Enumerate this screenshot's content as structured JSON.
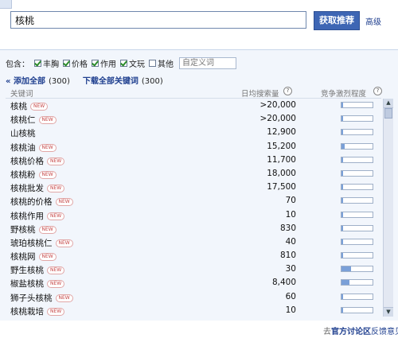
{
  "header": {
    "search_value": "核桃",
    "search_button": "获取推荐",
    "advanced_link": "高级"
  },
  "filters": {
    "label": "包含：",
    "options": [
      {
        "label": "丰胸",
        "checked": true
      },
      {
        "label": "价格",
        "checked": true
      },
      {
        "label": "作用",
        "checked": true
      },
      {
        "label": "文玩",
        "checked": true
      },
      {
        "label": "其他",
        "checked": false
      }
    ],
    "custom_placeholder": "自定义词"
  },
  "actions": {
    "add_all_arrow": "«",
    "add_all": "添加全部",
    "add_all_count": "(300)",
    "download_all": "下载全部关键词",
    "download_count": "(300)"
  },
  "table": {
    "headers": {
      "keyword": "关键词",
      "volume": "日均搜索量",
      "competition": "竞争激烈程度"
    },
    "rows": [
      {
        "keyword": "核桃",
        "new": true,
        "volume": ">20,000",
        "competition": 0.06
      },
      {
        "keyword": "核桃仁",
        "new": true,
        "volume": ">20,000",
        "competition": 0.06
      },
      {
        "keyword": "山核桃",
        "new": false,
        "volume": "12,900",
        "competition": 0.06
      },
      {
        "keyword": "核桃油",
        "new": true,
        "volume": "15,200",
        "competition": 0.1
      },
      {
        "keyword": "核桃价格",
        "new": true,
        "volume": "11,700",
        "competition": 0.06
      },
      {
        "keyword": "核桃粉",
        "new": true,
        "volume": "18,000",
        "competition": 0.06
      },
      {
        "keyword": "核桃批发",
        "new": true,
        "volume": "17,500",
        "competition": 0.06
      },
      {
        "keyword": "核桃的价格",
        "new": true,
        "volume": "70",
        "competition": 0.06
      },
      {
        "keyword": "核桃作用",
        "new": true,
        "volume": "10",
        "competition": 0.06
      },
      {
        "keyword": "野核桃",
        "new": true,
        "volume": "830",
        "competition": 0.06
      },
      {
        "keyword": "琥珀核桃仁",
        "new": true,
        "volume": "40",
        "competition": 0.06
      },
      {
        "keyword": "核桃网",
        "new": true,
        "volume": "810",
        "competition": 0.06
      },
      {
        "keyword": "野生核桃",
        "new": true,
        "volume": "30",
        "competition": 0.3
      },
      {
        "keyword": "椒盐核桃",
        "new": true,
        "volume": "8,400",
        "competition": 0.25
      },
      {
        "keyword": "狮子头核桃",
        "new": true,
        "volume": "60",
        "competition": 0.06
      },
      {
        "keyword": "核桃栽培",
        "new": true,
        "volume": "10",
        "competition": 0.06
      }
    ],
    "new_badge": "NEW",
    "help_icon_text": "?"
  },
  "scrollbar": {
    "up_glyph": "▲",
    "down_glyph": "▼"
  },
  "footer": {
    "prefix": "去",
    "forum": "官方讨论区",
    "feedback": "反馈意见"
  }
}
